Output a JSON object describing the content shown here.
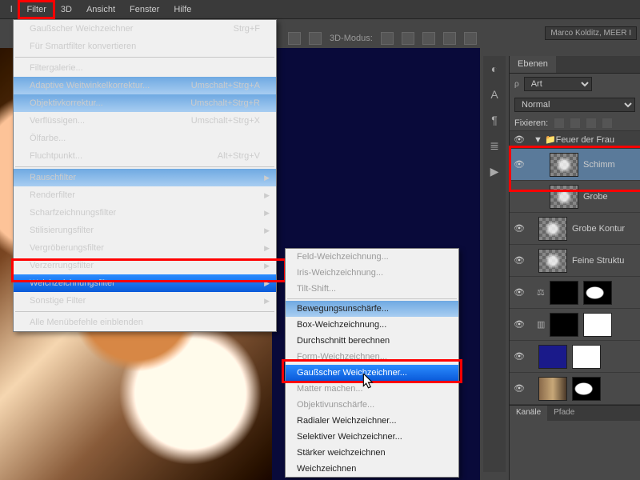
{
  "menubar": {
    "items": [
      "l",
      "Filter",
      "3D",
      "Ansicht",
      "Fenster",
      "Hilfe"
    ],
    "highlighted_index": 1
  },
  "userbox": "Marco Kolditz, MEER I",
  "secondbar": {
    "label": "3D-Modus:"
  },
  "filter_menu": {
    "rows": [
      {
        "label": "Gaußscher Weichzeichner",
        "shortcut": "Strg+F"
      },
      {
        "label": "Für Smartfilter konvertieren",
        "disabled": true
      },
      {
        "sep": true
      },
      {
        "label": "Filtergalerie..."
      },
      {
        "label": "Adaptive Weitwinkelkorrektur...",
        "shortcut": "Umschalt+Strg+A",
        "blue": true
      },
      {
        "label": "Objektivkorrektur...",
        "shortcut": "Umschalt+Strg+R",
        "blue": true
      },
      {
        "label": "Verflüssigen...",
        "shortcut": "Umschalt+Strg+X",
        "disabled": true
      },
      {
        "label": "Ölfarbe..."
      },
      {
        "label": "Fluchtpunkt...",
        "shortcut": "Alt+Strg+V",
        "disabled": true
      },
      {
        "sep": true
      },
      {
        "label": "Rauschfilter",
        "sub": true,
        "blue": true
      },
      {
        "label": "Renderfilter",
        "sub": true
      },
      {
        "label": "Scharfzeichnungsfilter",
        "sub": true
      },
      {
        "label": "Stilisierungsfilter",
        "sub": true
      },
      {
        "label": "Vergröberungsfilter",
        "sub": true
      },
      {
        "label": "Verzerrungsfilter",
        "sub": true,
        "disabled": true
      },
      {
        "label": "Weichzeichnungsfilter",
        "sub": true,
        "selected": true
      },
      {
        "label": "Sonstige Filter",
        "sub": true
      },
      {
        "sep": true
      },
      {
        "label": "Alle Menübefehle einblenden"
      }
    ]
  },
  "sub_menu": {
    "rows": [
      {
        "label": "Feld-Weichzeichnung...",
        "disabled": true
      },
      {
        "label": "Iris-Weichzeichnung...",
        "disabled": true
      },
      {
        "label": "Tilt-Shift...",
        "disabled": true
      },
      {
        "sep": true
      },
      {
        "label": "Bewegungsunschärfe...",
        "blue": true
      },
      {
        "label": "Box-Weichzeichnung..."
      },
      {
        "label": "Durchschnitt berechnen"
      },
      {
        "label": "Form-Weichzeichnen...",
        "disabled": true
      },
      {
        "label": "Gaußscher Weichzeichner...",
        "selected": true
      },
      {
        "label": "Matter machen...",
        "disabled": true
      },
      {
        "label": "Objektivunschärfe...",
        "disabled": true
      },
      {
        "label": "Radialer Weichzeichner..."
      },
      {
        "label": "Selektiver Weichzeichner..."
      },
      {
        "label": "Stärker weichzeichnen"
      },
      {
        "label": "Weichzeichnen"
      }
    ]
  },
  "layers_panel": {
    "tab": "Ebenen",
    "filter_label": "Art",
    "blend": "Normal",
    "lock_label": "Fixieren:",
    "folder": "Feuer der Frau",
    "layers": [
      {
        "name": "Schimm",
        "thumb": "smoke",
        "selected": true
      },
      {
        "name": "Grobe",
        "thumb": "smoke"
      },
      {
        "name": "Grobe Kontur",
        "thumb": "smoke"
      },
      {
        "name": "Feine Struktu",
        "thumb": "smoke"
      },
      {
        "name": "",
        "thumb": "black",
        "mask": "sil",
        "icon": "balance"
      },
      {
        "name": "",
        "thumb": "black",
        "mask": "white",
        "icon": "levels"
      },
      {
        "name": "",
        "thumb": "blue",
        "mask": "white"
      },
      {
        "name": "",
        "thumb": "photo",
        "mask": "sil"
      }
    ],
    "bottom_tabs": [
      "Kanäle",
      "Pfade"
    ]
  }
}
